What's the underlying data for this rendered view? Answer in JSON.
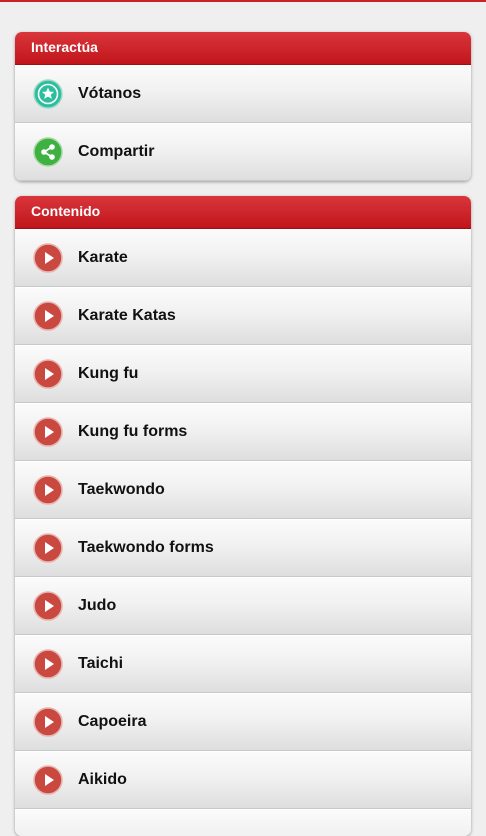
{
  "colors": {
    "header_red": "#c8232a",
    "play_red": "#c9483f",
    "star_teal": "#2bbf9d",
    "share_green": "#3fb042"
  },
  "interact": {
    "title": "Interactúa",
    "items": [
      {
        "label": "Vótanos",
        "icon": "star-icon"
      },
      {
        "label": "Compartir",
        "icon": "share-icon"
      }
    ]
  },
  "content": {
    "title": "Contenido",
    "items": [
      {
        "label": "Karate",
        "icon": "play-icon"
      },
      {
        "label": "Karate Katas",
        "icon": "play-icon"
      },
      {
        "label": "Kung fu",
        "icon": "play-icon"
      },
      {
        "label": "Kung fu forms",
        "icon": "play-icon"
      },
      {
        "label": "Taekwondo",
        "icon": "play-icon"
      },
      {
        "label": "Taekwondo forms",
        "icon": "play-icon"
      },
      {
        "label": "Judo",
        "icon": "play-icon"
      },
      {
        "label": "Taichi",
        "icon": "play-icon"
      },
      {
        "label": "Capoeira",
        "icon": "play-icon"
      },
      {
        "label": "Aikido",
        "icon": "play-icon"
      }
    ]
  }
}
